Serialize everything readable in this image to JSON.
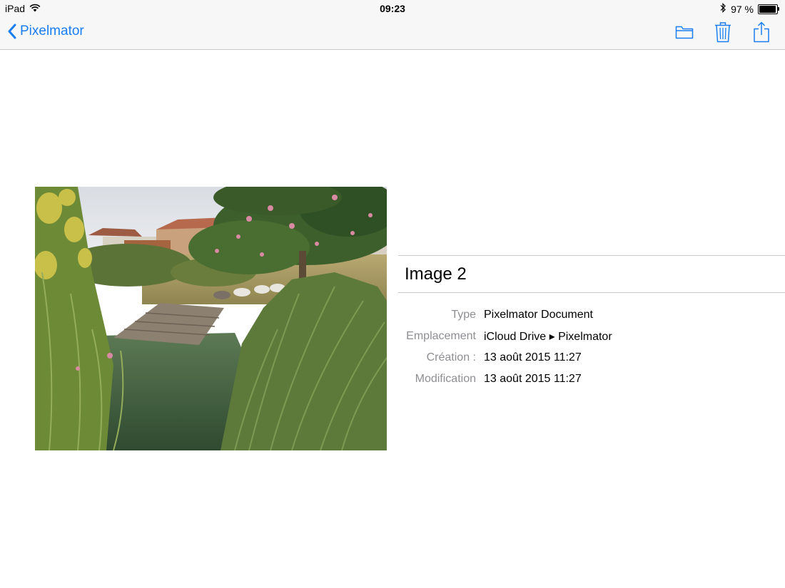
{
  "status_bar": {
    "device": "iPad",
    "time": "09:23",
    "battery_text": "97 %",
    "battery_level": 0.97
  },
  "nav": {
    "back_label": "Pixelmator",
    "actions": [
      "folder-icon",
      "trash-icon",
      "share-icon"
    ]
  },
  "document": {
    "title": "Image 2",
    "details": [
      {
        "label": "Type",
        "value": "Pixelmator Document"
      },
      {
        "label": "Emplacement",
        "value": "iCloud Drive ▸ Pixelmator"
      },
      {
        "label": "Création :",
        "value": "13 août 2015 11:27"
      },
      {
        "label": "Modification",
        "value": "13 août 2015 11:27"
      }
    ]
  },
  "colors": {
    "accent": "#1a7ef2",
    "label_gray": "#8e8e93",
    "separator": "#c8c8cc",
    "bar_background": "#f7f7f7"
  }
}
